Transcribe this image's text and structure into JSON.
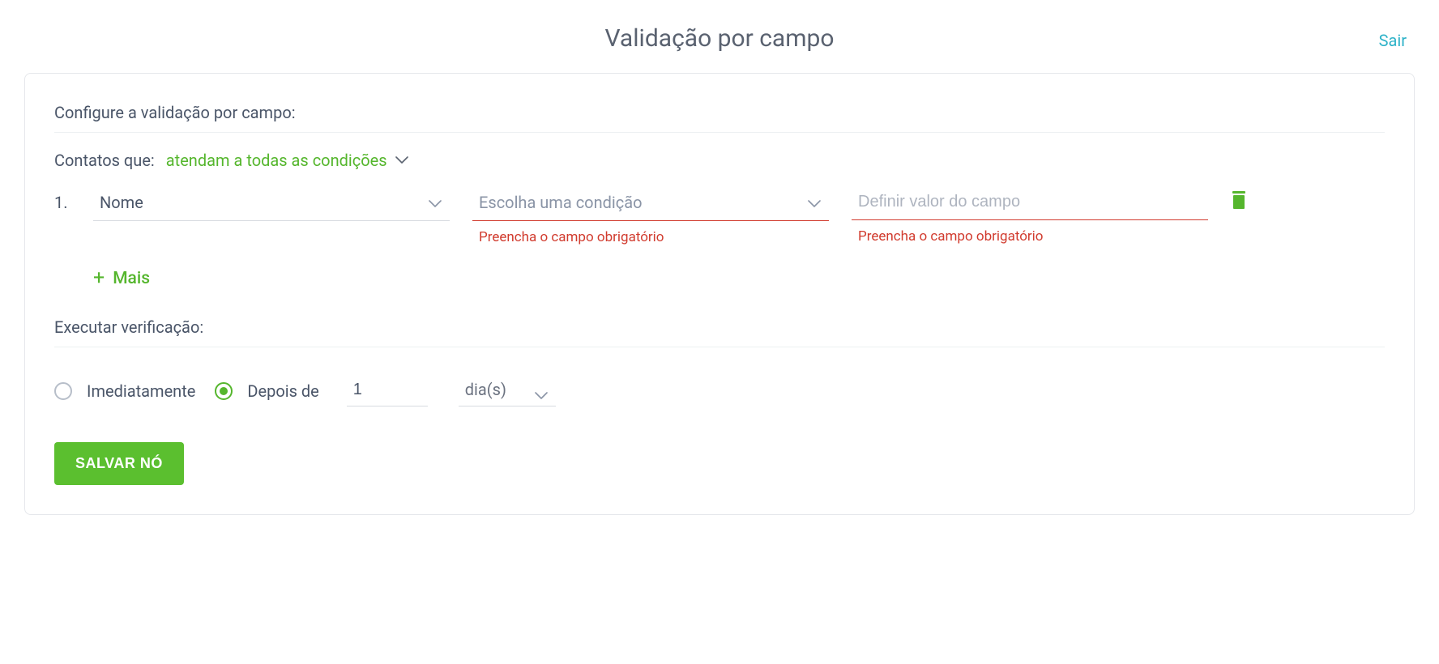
{
  "header": {
    "title": "Validação por campo",
    "exit": "Sair"
  },
  "config": {
    "section_label": "Configure a validação por campo:",
    "contacts_label": "Contatos que:",
    "match_type": "atendam a todas as condições",
    "rows": [
      {
        "index": "1.",
        "field": "Nome",
        "condition_placeholder": "Escolha uma condição",
        "condition_error": "Preencha o campo obrigatório",
        "value_placeholder": "Definir valor do campo",
        "value_error": "Preencha o campo obrigatório"
      }
    ],
    "add_more": "Mais"
  },
  "exec": {
    "section_label": "Executar verificação:",
    "immediate_label": "Imediatamente",
    "after_label": "Depois de",
    "delay_value": "1",
    "delay_unit": "dia(s)",
    "selected": "after"
  },
  "actions": {
    "save": "SALVAR NÓ"
  }
}
